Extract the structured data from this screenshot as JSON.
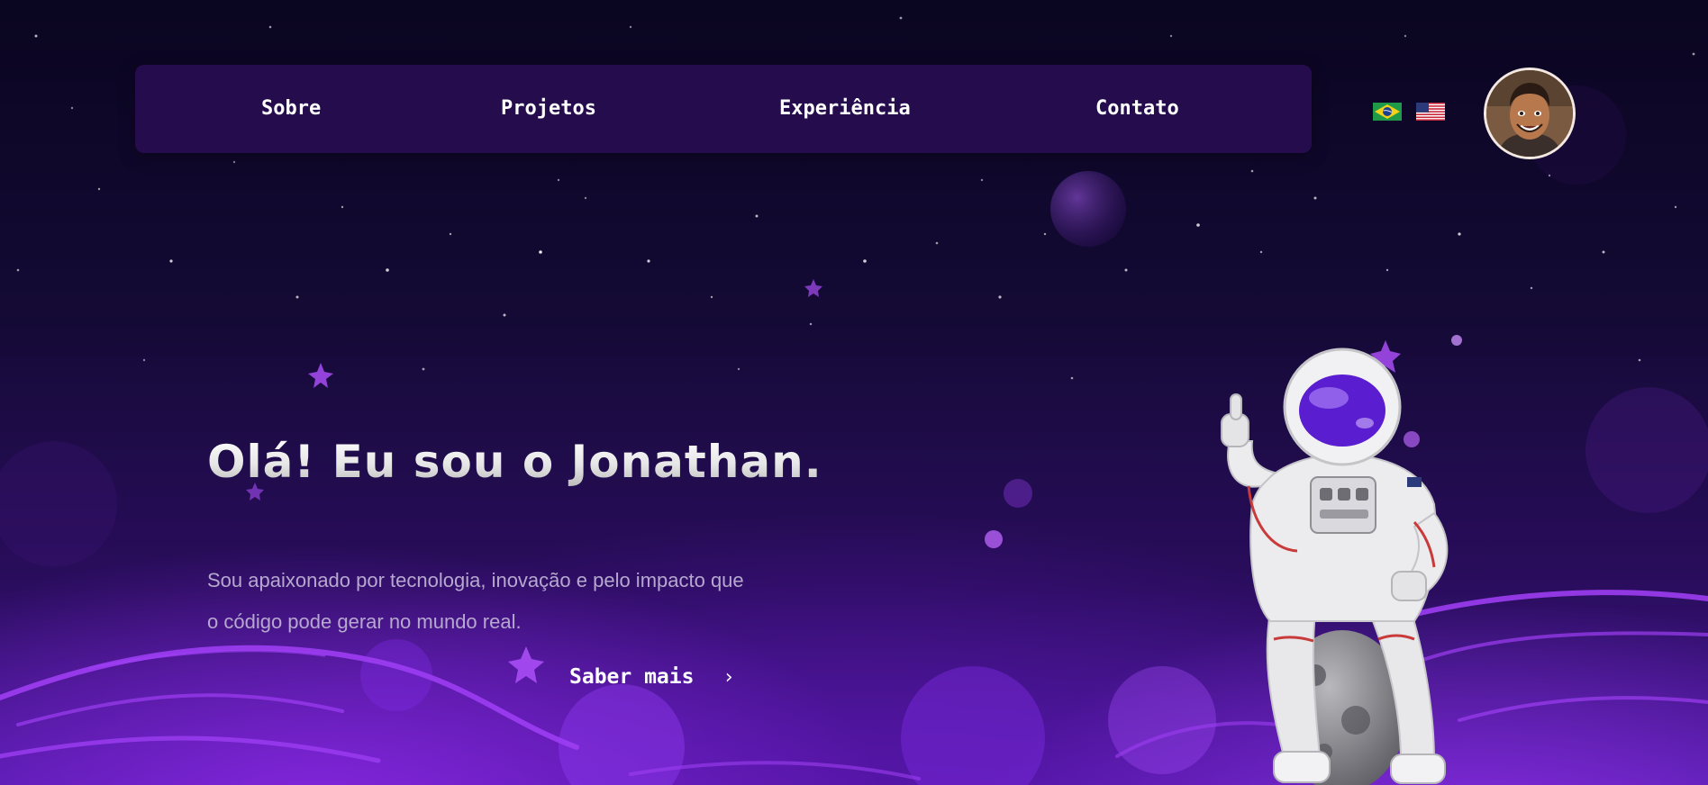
{
  "nav": {
    "items": [
      {
        "label": "Sobre"
      },
      {
        "label": "Projetos"
      },
      {
        "label": "Experiência"
      },
      {
        "label": "Contato"
      }
    ]
  },
  "languages": [
    {
      "icon": "brazil-flag-icon"
    },
    {
      "icon": "usa-flag-icon"
    }
  ],
  "hero": {
    "title": "Olá! Eu sou o Jonathan.",
    "line1": "Sou apaixonado por tecnologia, inovação e pelo impacto que",
    "line2": "o código pode gerar no mundo real.",
    "cta_label": "Saber mais",
    "cta_icon": "chevron-right-icon"
  },
  "colors": {
    "nav_bg": "#250c4d",
    "accent": "#8b2be2",
    "text_muted": "#b6a8cf"
  }
}
